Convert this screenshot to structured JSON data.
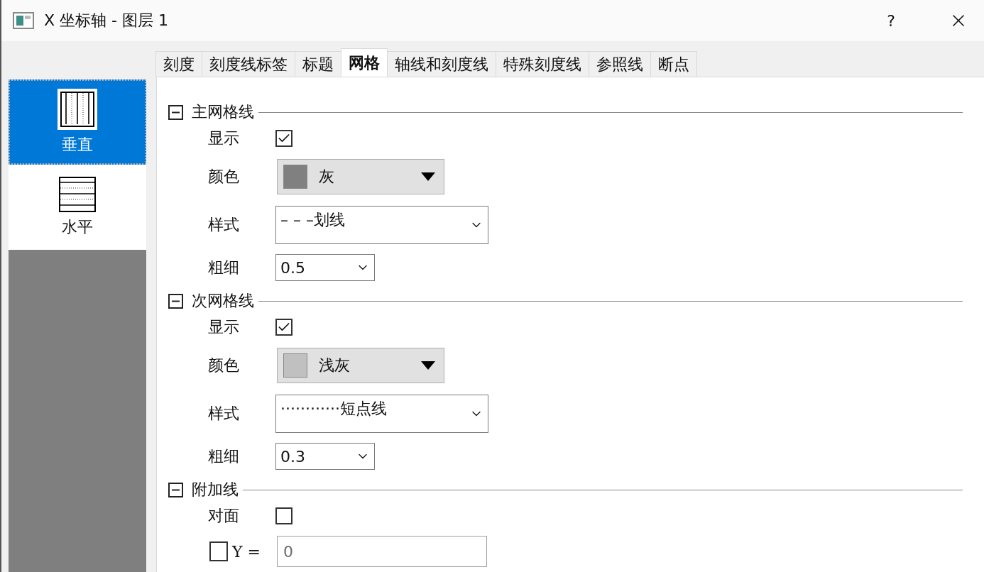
{
  "window": {
    "title": "X 坐标轴 - 图层 1",
    "help": "?"
  },
  "tabs": [
    {
      "label": "刻度",
      "selected": false
    },
    {
      "label": "刻度线标签",
      "selected": false
    },
    {
      "label": "标题",
      "selected": false
    },
    {
      "label": "网格",
      "selected": true
    },
    {
      "label": "轴线和刻度线",
      "selected": false
    },
    {
      "label": "特殊刻度线",
      "selected": false
    },
    {
      "label": "参照线",
      "selected": false
    },
    {
      "label": "断点",
      "selected": false
    }
  ],
  "sidebar": {
    "items": [
      {
        "label": "垂直",
        "kind": "vertical",
        "selected": true
      },
      {
        "label": "水平",
        "kind": "horizontal",
        "selected": false
      }
    ]
  },
  "sections": [
    {
      "title": "主网格线",
      "expanded": true,
      "rows": [
        {
          "kind": "checkbox",
          "label": "显示",
          "checked": true
        },
        {
          "kind": "color",
          "label": "颜色",
          "value": "灰",
          "color": "#808080"
        },
        {
          "kind": "style",
          "label": "样式",
          "value": "– – –划线"
        },
        {
          "kind": "width",
          "label": "粗细",
          "value": "0.5"
        }
      ]
    },
    {
      "title": "次网格线",
      "expanded": true,
      "rows": [
        {
          "kind": "checkbox",
          "label": "显示",
          "checked": true
        },
        {
          "kind": "color",
          "label": "颜色",
          "value": "浅灰",
          "color": "#c0c0c0"
        },
        {
          "kind": "style",
          "label": "样式",
          "value": "············短点线"
        },
        {
          "kind": "width",
          "label": "粗细",
          "value": "0.3"
        }
      ]
    },
    {
      "title": "附加线",
      "expanded": true,
      "rows": [
        {
          "kind": "checkbox",
          "label": "对面",
          "checked": false
        },
        {
          "kind": "value",
          "label": "Y =",
          "checked": false,
          "value": "0",
          "disabled": true
        }
      ]
    }
  ]
}
